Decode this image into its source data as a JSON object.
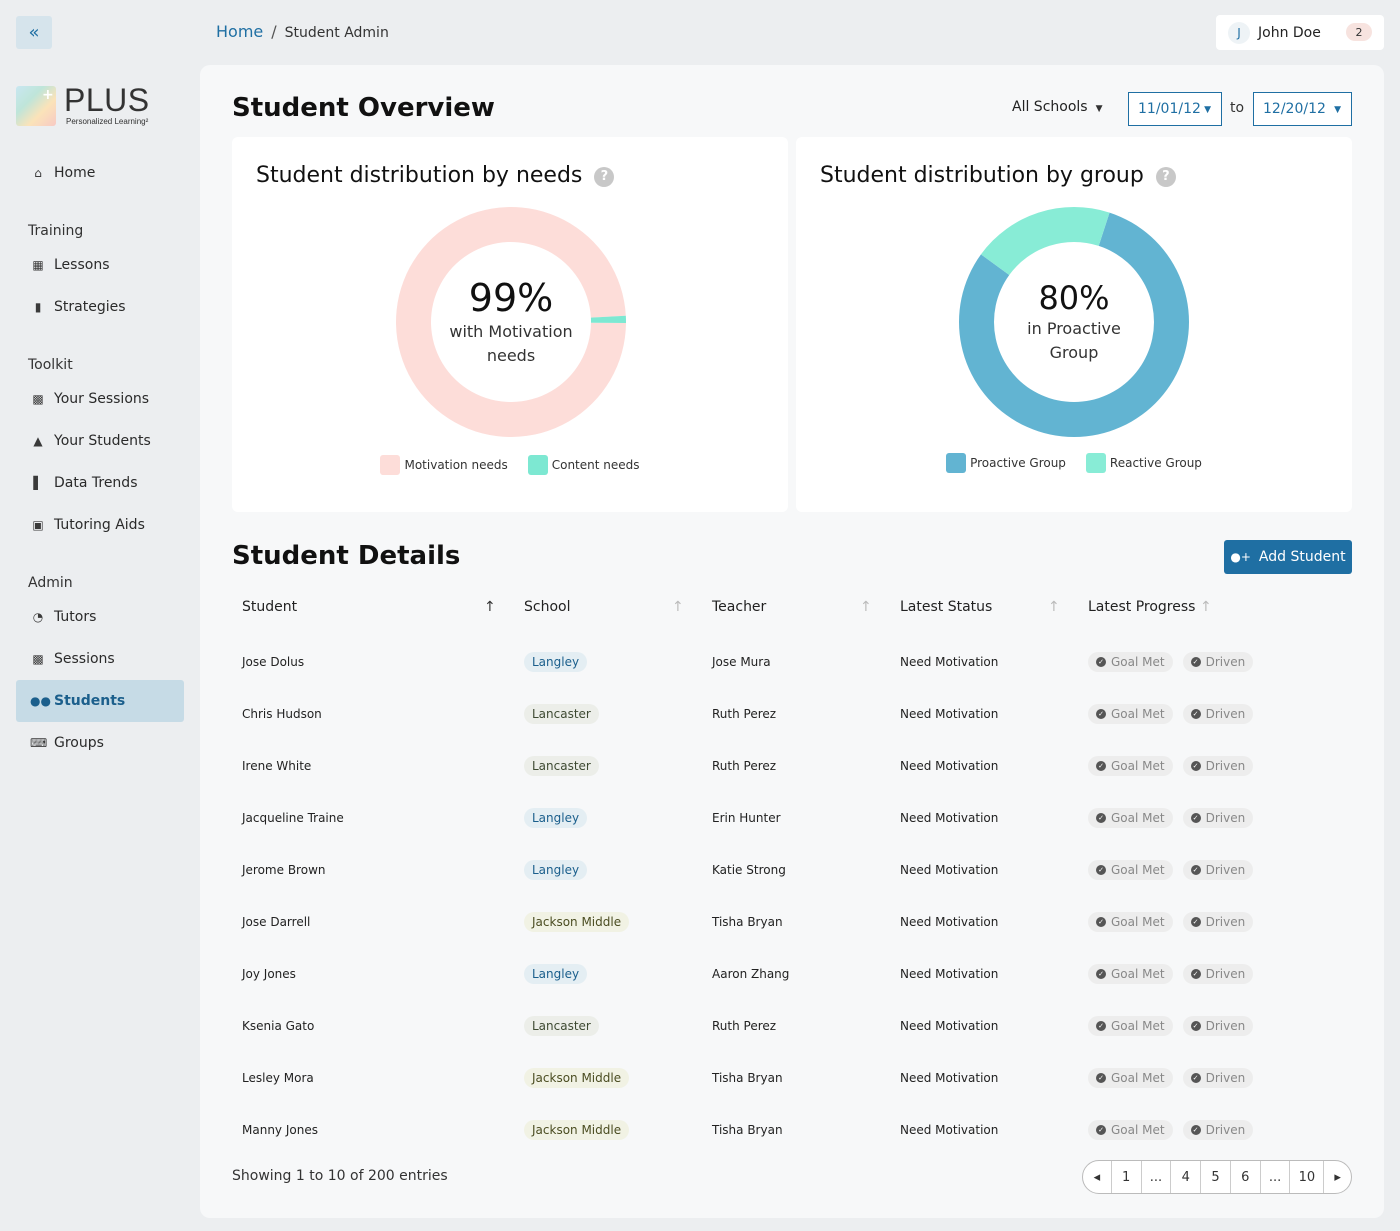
{
  "sidebar": {
    "collapse_glyph": "«",
    "logo": {
      "name": "PLUS",
      "tagline": "Personalized Learning²"
    },
    "items": {
      "home": "Home",
      "training": "Training",
      "lessons": "Lessons",
      "strategies": "Strategies",
      "toolkit": "Toolkit",
      "your_sessions": "Your Sessions",
      "your_students": "Your Students",
      "data_trends": "Data Trends",
      "tutoring_aids": "Tutoring Aids",
      "admin": "Admin",
      "tutors": "Tutors",
      "sessions": "Sessions",
      "students": "Students",
      "groups": "Groups"
    },
    "active_item": "students"
  },
  "breadcrumb": {
    "home": "Home",
    "separator": "/",
    "current": "Student Admin"
  },
  "user": {
    "initial": "J",
    "name": "John Doe",
    "notifications": "2"
  },
  "overview": {
    "title": "Student Overview",
    "school_filter": "All Schools",
    "date_from": "11/01/12",
    "date_to_label": "to",
    "date_to": "12/20/12"
  },
  "needs_card": {
    "title": "Student distribution by needs",
    "center_value": "99%",
    "center_label": "with Motivation needs",
    "legend": [
      "Motivation needs",
      "Content needs"
    ]
  },
  "group_card": {
    "title": "Student distribution by group",
    "center_value": "80%",
    "center_label": "in Proactive Group",
    "legend": [
      "Proactive Group",
      "Reactive Group"
    ]
  },
  "chart_data": [
    {
      "type": "pie",
      "categories": [
        "Motivation needs",
        "Content needs"
      ],
      "values": [
        99,
        1
      ],
      "colors": [
        "#fdddd9",
        "#7de8d2"
      ]
    },
    {
      "type": "pie",
      "categories": [
        "Proactive Group",
        "Reactive Group"
      ],
      "values": [
        80,
        20
      ],
      "colors": [
        "#62b4d2",
        "#88ecd6"
      ]
    }
  ],
  "details": {
    "title": "Student Details",
    "add_button": "Add Student",
    "columns": [
      "Student",
      "School",
      "Teacher",
      "Latest Status",
      "Latest Progress"
    ],
    "rows": [
      {
        "student": "Jose Dolus",
        "school": "Langley",
        "teacher": "Jose Mura",
        "status": "Need Motivation",
        "progress": [
          "Goal Met",
          "Driven"
        ]
      },
      {
        "student": "Chris Hudson",
        "school": "Lancaster",
        "teacher": "Ruth Perez",
        "status": "Need Motivation",
        "progress": [
          "Goal Met",
          "Driven"
        ]
      },
      {
        "student": "Irene White",
        "school": "Lancaster",
        "teacher": "Ruth Perez",
        "status": "Need Motivation",
        "progress": [
          "Goal Met",
          "Driven"
        ]
      },
      {
        "student": "Jacqueline Traine",
        "school": "Langley",
        "teacher": "Erin Hunter",
        "status": "Need Motivation",
        "progress": [
          "Goal Met",
          "Driven"
        ]
      },
      {
        "student": "Jerome Brown",
        "school": "Langley",
        "teacher": "Katie Strong",
        "status": "Need Motivation",
        "progress": [
          "Goal Met",
          "Driven"
        ]
      },
      {
        "student": "Jose Darrell",
        "school": "Jackson Middle",
        "teacher": "Tisha Bryan",
        "status": "Need Motivation",
        "progress": [
          "Goal Met",
          "Driven"
        ]
      },
      {
        "student": "Joy Jones",
        "school": "Langley",
        "teacher": "Aaron Zhang",
        "status": "Need Motivation",
        "progress": [
          "Goal Met",
          "Driven"
        ]
      },
      {
        "student": "Ksenia Gato",
        "school": "Lancaster",
        "teacher": "Ruth Perez",
        "status": "Need Motivation",
        "progress": [
          "Goal Met",
          "Driven"
        ]
      },
      {
        "student": "Lesley Mora",
        "school": "Jackson Middle",
        "teacher": "Tisha Bryan",
        "status": "Need Motivation",
        "progress": [
          "Goal Met",
          "Driven"
        ]
      },
      {
        "student": "Manny Jones",
        "school": "Jackson Middle",
        "teacher": "Tisha Bryan",
        "status": "Need Motivation",
        "progress": [
          "Goal Met",
          "Driven"
        ]
      }
    ],
    "showing": "Showing 1 to 10 of 200 entries",
    "pagination": [
      "1",
      "...",
      "4",
      "5",
      "6",
      "...",
      "10"
    ]
  }
}
